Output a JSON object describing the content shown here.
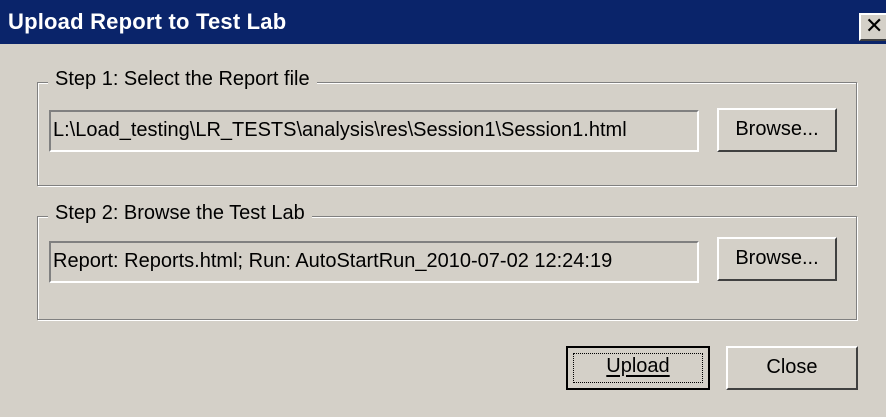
{
  "window": {
    "title": "Upload Report to Test Lab",
    "close_glyph": "✕",
    "close_icon": "close-x-icon"
  },
  "step1": {
    "legend": "Step 1: Select the Report file",
    "path_value": "L:\\Load_testing\\LR_TESTS\\analysis\\res\\Session1\\Session1.html",
    "browse_label": "Browse..."
  },
  "step2": {
    "legend": "Step 2: Browse the Test Lab",
    "selection_value": "Report: Reports.html; Run: AutoStartRun_2010-07-02 12:24:19",
    "browse_label": "Browse..."
  },
  "buttons": {
    "upload_label": "Upload",
    "close_label": "Close"
  },
  "colors": {
    "titlebar": "#0a246a",
    "face": "#d4d0c8"
  }
}
